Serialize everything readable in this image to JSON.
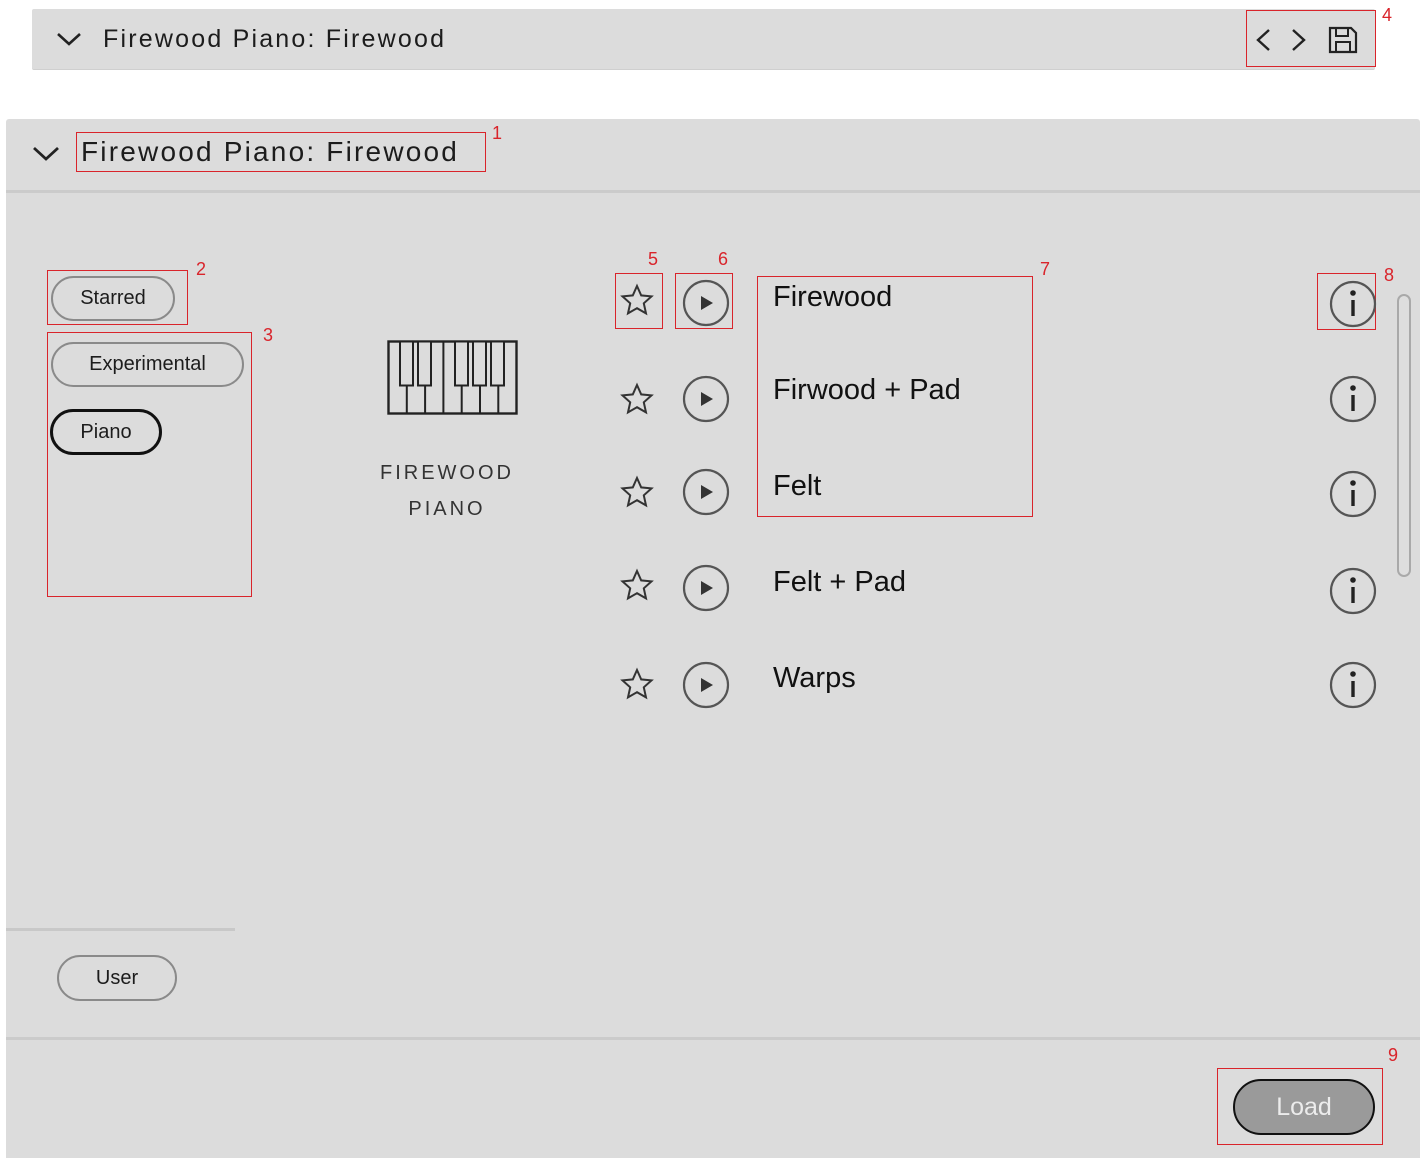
{
  "topbar": {
    "title": "Firewood Piano: Firewood",
    "prev_icon": "chevron-left-icon",
    "next_icon": "chevron-right-icon",
    "save_icon": "save-icon",
    "annotation": "4"
  },
  "panel": {
    "title": "Firewood Piano: Firewood",
    "title_annotation": "1"
  },
  "filters": {
    "starred_label": "Starred",
    "starred_annotation": "2",
    "tags_annotation": "3",
    "tags": [
      {
        "label": "Experimental",
        "active": false
      },
      {
        "label": "Piano",
        "active": true
      }
    ],
    "user_label": "User"
  },
  "instrument": {
    "icon": "piano-keyboard-icon",
    "name_line1": "FIREWOOD",
    "name_line2": "PIANO"
  },
  "presets": {
    "star_annotation": "5",
    "play_annotation": "6",
    "names_annotation": "7",
    "info_annotation": "8",
    "items": [
      {
        "name": "Firewood"
      },
      {
        "name": "Firwood + Pad"
      },
      {
        "name": "Felt"
      },
      {
        "name": "Felt + Pad"
      },
      {
        "name": "Warps"
      }
    ]
  },
  "footer": {
    "load_label": "Load",
    "load_annotation": "9"
  },
  "colors": {
    "panel_bg": "#dcdcdc",
    "annotation": "#d9242b",
    "load_bg": "#9a9a9a"
  }
}
